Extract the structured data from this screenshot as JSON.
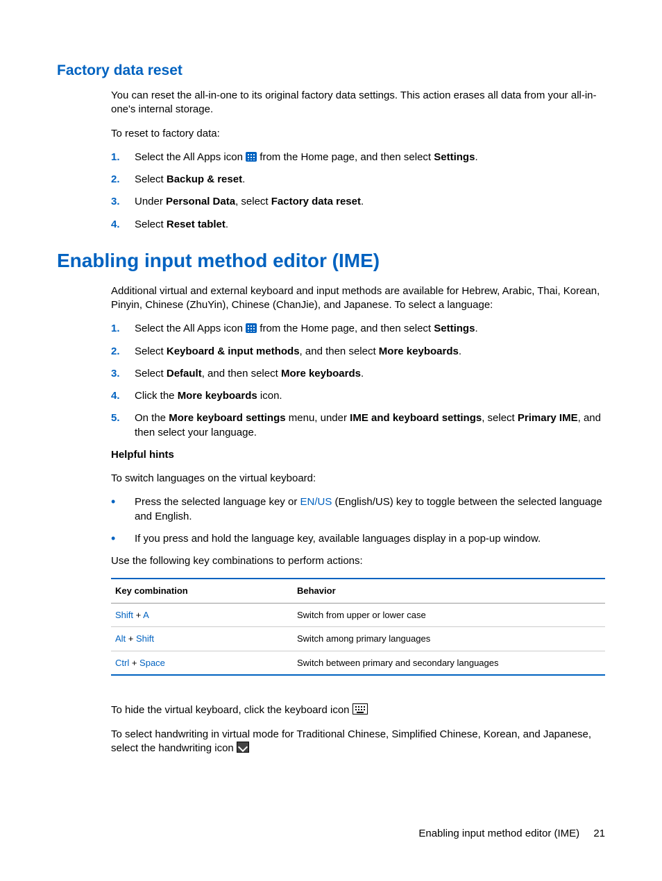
{
  "section1": {
    "heading": "Factory data reset",
    "intro": "You can reset the all-in-one to its original factory data settings. This action erases all data from your all-in-one's internal storage.",
    "lead": "To reset to factory data:",
    "steps": {
      "s1a": "Select the All Apps icon ",
      "s1b": " from the Home page, and then select ",
      "s1c": "Settings",
      "s1d": ".",
      "s2a": "Select ",
      "s2b": "Backup & reset",
      "s2c": ".",
      "s3a": "Under ",
      "s3b": "Personal Data",
      "s3c": ", select ",
      "s3d": "Factory data reset",
      "s3e": ".",
      "s4a": "Select ",
      "s4b": "Reset tablet",
      "s4c": "."
    }
  },
  "section2": {
    "heading": "Enabling input method editor (IME)",
    "intro": "Additional virtual and external keyboard and input methods are available for Hebrew, Arabic, Thai, Korean, Pinyin, Chinese (ZhuYin), Chinese (ChanJie), and Japanese. To select a language:",
    "steps": {
      "s1a": "Select the All Apps icon ",
      "s1b": " from the Home page, and then select ",
      "s1c": "Settings",
      "s1d": ".",
      "s2a": "Select ",
      "s2b": "Keyboard & input methods",
      "s2c": ", and then select ",
      "s2d": "More keyboards",
      "s2e": ".",
      "s3a": "Select ",
      "s3b": "Default",
      "s3c": ", and then select ",
      "s3d": "More keyboards",
      "s3e": ".",
      "s4a": "Click the ",
      "s4b": "More keyboards",
      "s4c": " icon.",
      "s5a": "On the ",
      "s5b": "More keyboard settings",
      "s5c": " menu, under ",
      "s5d": "IME and keyboard settings",
      "s5e": ", select ",
      "s5f": "Primary IME",
      "s5g": ", and then select your language."
    },
    "hints_heading": "Helpful hints",
    "hints_intro": "To switch languages on the virtual keyboard:",
    "bullets": {
      "b1a": "Press the selected language key or ",
      "b1b": "EN/US",
      "b1c": " (English/US) key to toggle between the selected language and English.",
      "b2": "If you press and hold the language key, available languages display in a pop-up window."
    },
    "table_intro": "Use the following key combinations to perform actions:",
    "table": {
      "h1": "Key combination",
      "h2": "Behavior",
      "r1k1": "Shift",
      "r1p": " + ",
      "r1k2": "A",
      "r1b": "Switch from upper or lower case",
      "r2k1": "Alt",
      "r2p": " + ",
      "r2k2": "Shift",
      "r2b": "Switch among primary languages",
      "r3k1": "Ctrl",
      "r3p": " + ",
      "r3k2": "Space",
      "r3b": "Switch between primary and secondary languages"
    },
    "after1": "To hide the virtual keyboard, click the keyboard icon ",
    "after2": "To select handwriting in virtual mode for Traditional Chinese, Simplified Chinese, Korean, and Japanese, select the handwriting icon "
  },
  "footer": {
    "title": "Enabling input method editor (IME)",
    "page": "21"
  },
  "nums": {
    "n1": "1.",
    "n2": "2.",
    "n3": "3.",
    "n4": "4.",
    "n5": "5."
  }
}
